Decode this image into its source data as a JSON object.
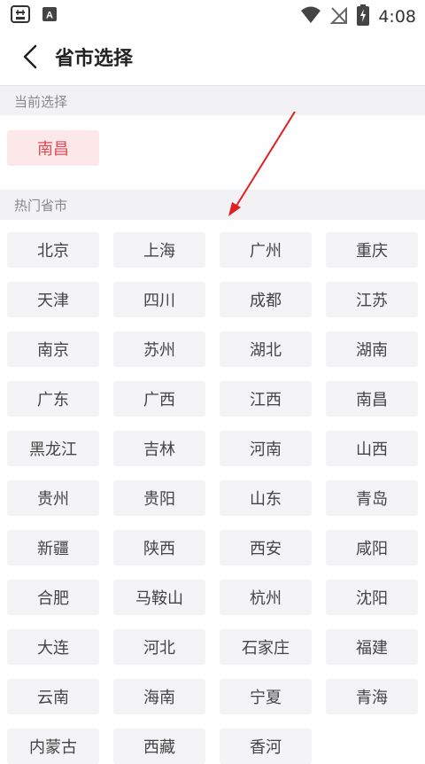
{
  "status_bar": {
    "time": "4:08",
    "left_icons": [
      "sim-card-icon",
      "font-a-icon"
    ],
    "right_icons": [
      "wifi-icon",
      "no-signal-icon",
      "battery-charging-icon"
    ]
  },
  "header": {
    "back_icon": "chevron-left-icon",
    "title": "省市选择"
  },
  "current": {
    "label": "当前选择",
    "selected": "南昌",
    "accent_color": "#e14b52"
  },
  "hot": {
    "label": "热门省市",
    "cities": [
      "北京",
      "上海",
      "广州",
      "重庆",
      "天津",
      "四川",
      "成都",
      "江苏",
      "南京",
      "苏州",
      "湖北",
      "湖南",
      "广东",
      "广西",
      "江西",
      "南昌",
      "黑龙江",
      "吉林",
      "河南",
      "山西",
      "贵州",
      "贵阳",
      "山东",
      "青岛",
      "新疆",
      "陕西",
      "西安",
      "咸阳",
      "合肥",
      "马鞍山",
      "杭州",
      "沈阳",
      "大连",
      "河北",
      "石家庄",
      "福建",
      "云南",
      "海南",
      "宁夏",
      "青海",
      "内蒙古",
      "西藏",
      "香河"
    ]
  },
  "annotation": {
    "arrow_color": "#e02020"
  }
}
